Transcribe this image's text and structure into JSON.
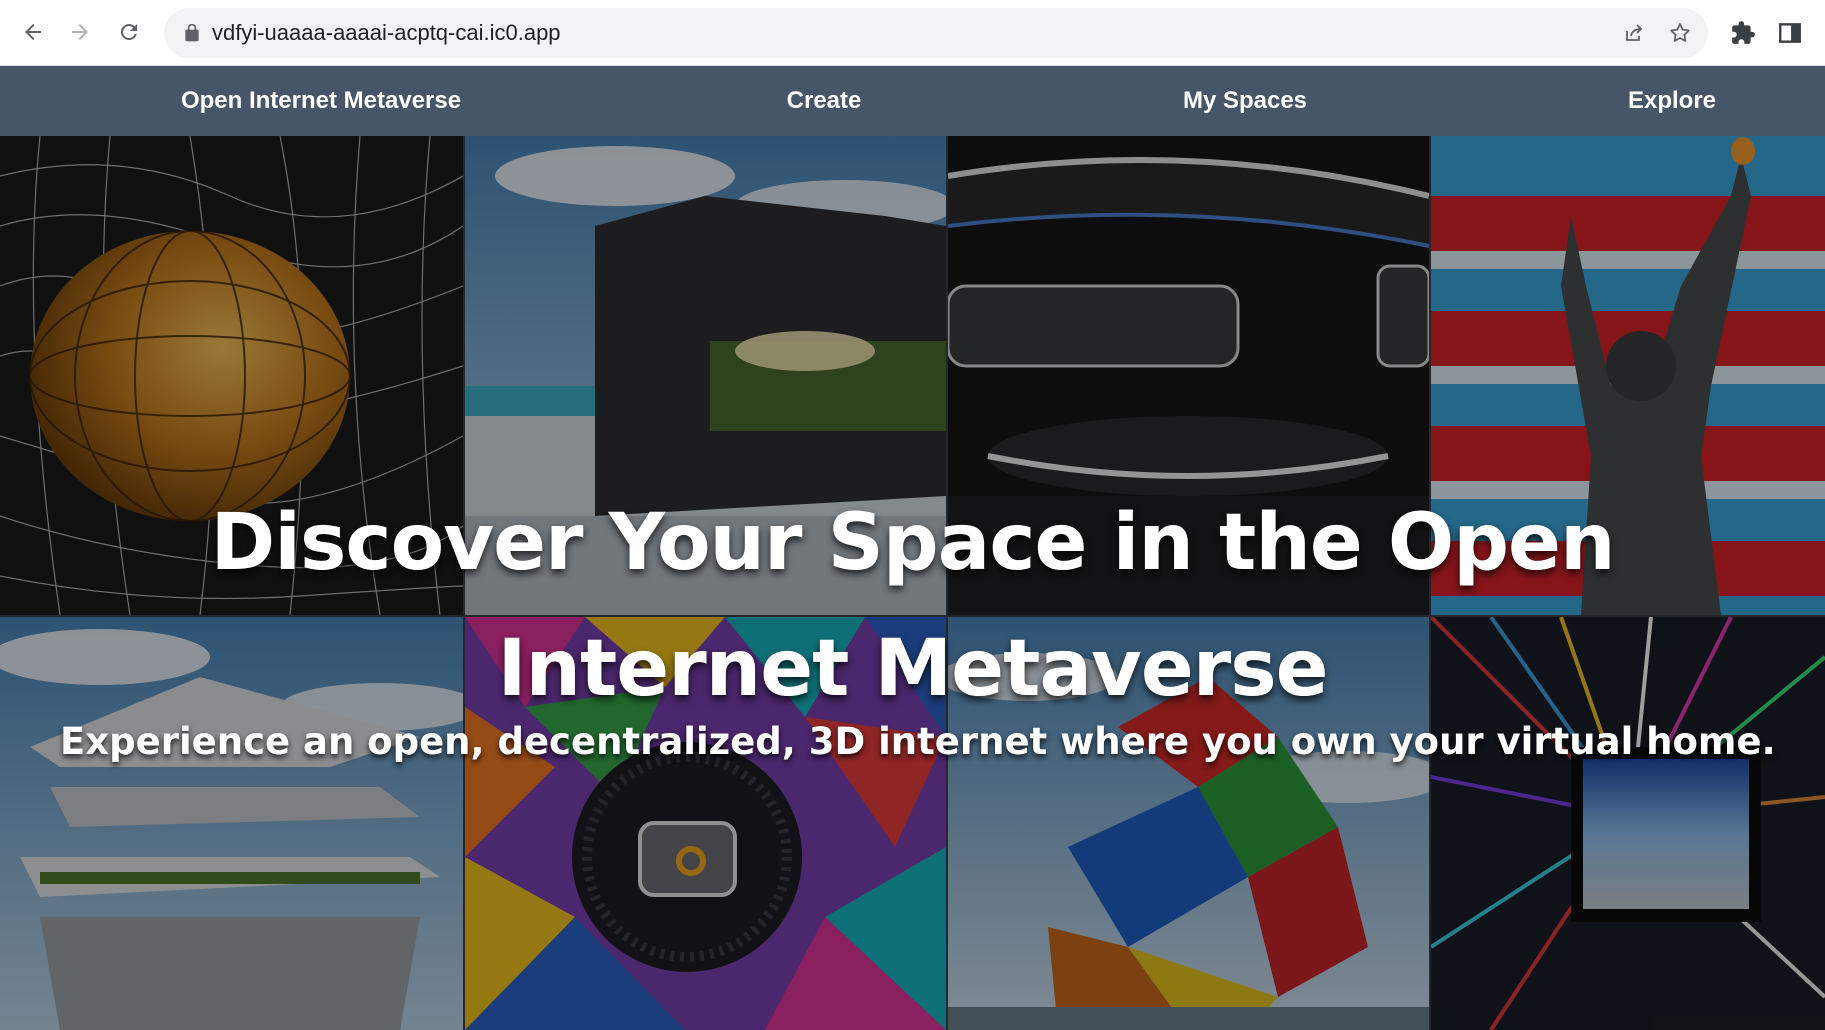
{
  "browser": {
    "url": "vdfyi-uaaaa-aaaai-acptq-cai.ic0.app",
    "icons": {
      "back": "arrow-left-icon",
      "forward": "arrow-right-icon",
      "reload": "reload-icon",
      "lock": "lock-icon",
      "share": "share-icon",
      "bookmark": "star-icon",
      "extensions": "puzzle-icon",
      "side_panel": "side-panel-icon"
    }
  },
  "nav": {
    "brand": "Open Internet Metaverse",
    "create": "Create",
    "my_spaces": "My Spaces",
    "explore": "Explore",
    "background_color": "#475569"
  },
  "hero": {
    "title": "Discover Your Space in the Open Internet Metaverse",
    "subtitle": "Experience an open, decentralized, 3D internet where you own your virtual home.",
    "tiles": [
      "wireframe-globe-image",
      "white-building-screen-image",
      "futuristic-interior-image",
      "statue-of-liberty-flag-image",
      "layered-floating-house-image",
      "colorful-mosaic-logo-image",
      "colorful-cubes-sky-image",
      "hyperspace-tunnel-image"
    ]
  }
}
